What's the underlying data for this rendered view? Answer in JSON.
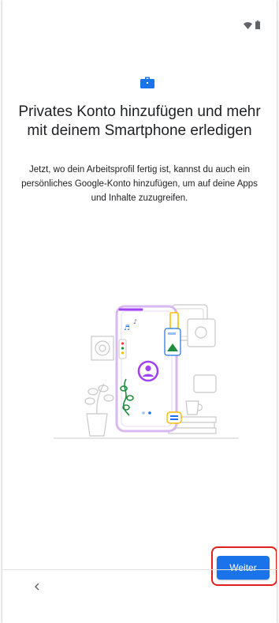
{
  "icons": {
    "status": [
      "wifi-icon",
      "battery-icon"
    ],
    "hero": "briefcase-icon",
    "back": "chevron-left-icon"
  },
  "colors": {
    "accent": "#1a73e8",
    "hero_icon": "#1a73e8",
    "illustration_purple": "#a142f4",
    "illustration_green": "#1e8e3e",
    "illustration_yellow": "#fbbc04",
    "highlight": "#e0201b"
  },
  "content": {
    "title": "Privates Konto hinzufügen und mehr mit deinem Smartphone erledigen",
    "description": "Jetzt, wo dein Arbeitsprofil fertig ist, kannst du auch ein persönliches Google-Konto hinzufügen, um auf deine Apps und Inhalte zuzugreifen."
  },
  "footer": {
    "next_label": "Weiter"
  }
}
